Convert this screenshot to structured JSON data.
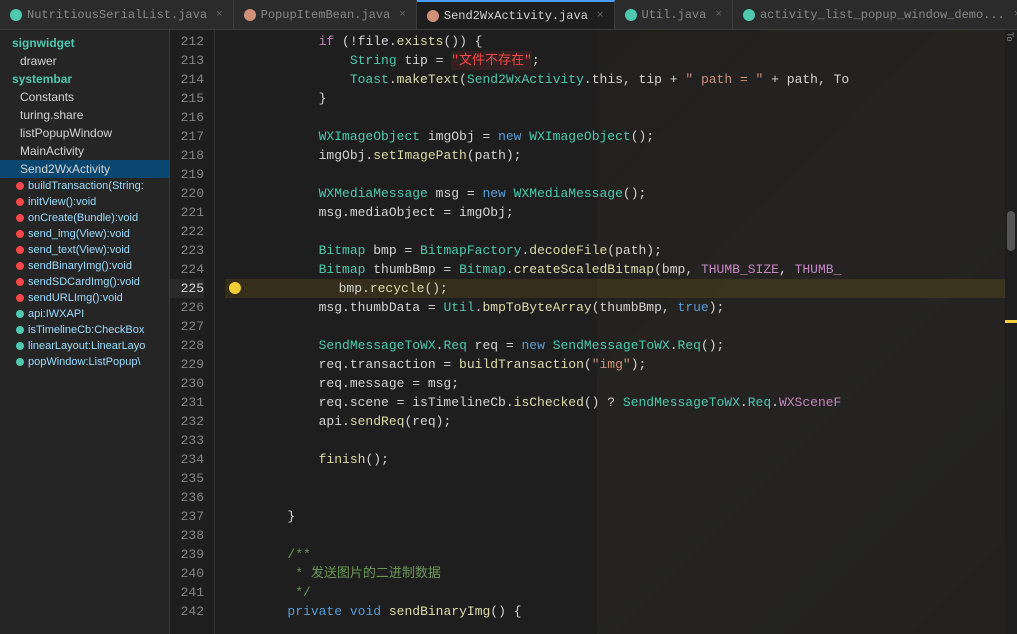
{
  "tabs": [
    {
      "label": "NutritiousSerialList.java",
      "icon": "green",
      "active": false
    },
    {
      "label": "PopupItemBean.java",
      "icon": "orange",
      "active": false
    },
    {
      "label": "Send2WxActivity.java",
      "icon": "orange",
      "active": true
    },
    {
      "label": "Util.java",
      "icon": "green",
      "active": false
    },
    {
      "label": "activity_list_popup_window_demo...",
      "icon": "green",
      "active": false
    }
  ],
  "sidebar": {
    "sections": [
      {
        "label": "signwidget",
        "type": "section-header"
      },
      {
        "label": "drawer",
        "type": "sub-item"
      },
      {
        "label": "systembar",
        "type": "section-header"
      },
      {
        "label": "Constants",
        "type": "sub-item"
      },
      {
        "label": "turing.share",
        "type": "sub-item"
      },
      {
        "label": "listPopupWindow",
        "type": "sub-item"
      },
      {
        "label": "MainActivity",
        "type": "sub-item"
      },
      {
        "label": "Send2WxActivity",
        "type": "sub-item",
        "selected": true
      }
    ],
    "methods": [
      {
        "label": "buildTransaction(String:",
        "dot": "red"
      },
      {
        "label": "initView():void",
        "dot": "red"
      },
      {
        "label": "onCreate(Bundle):void",
        "dot": "red"
      },
      {
        "label": "send_img(View):void",
        "dot": "red"
      },
      {
        "label": "send_text(View):void",
        "dot": "red"
      },
      {
        "label": "sendBinaryImg():void",
        "dot": "red"
      },
      {
        "label": "sendSDCardImg():void",
        "dot": "red"
      },
      {
        "label": "sendURLImg():void",
        "dot": "red"
      },
      {
        "label": "api:IWXAPI",
        "dot": "green"
      },
      {
        "label": "isTimelineCb:CheckBox",
        "dot": "green"
      },
      {
        "label": "linearLayout:LinearLayo",
        "dot": "green"
      },
      {
        "label": "popWindow:ListPopup\\",
        "dot": "green"
      }
    ]
  },
  "lines": [
    {
      "num": 212,
      "content": "if (!file.exists()) {",
      "indent": 3
    },
    {
      "num": 213,
      "content": "String tip = \"文件不存在\";",
      "indent": 4
    },
    {
      "num": 214,
      "content": "Toast.makeText(Send2WxActivity.this, tip + \" path = \" + path, To",
      "indent": 4
    },
    {
      "num": 215,
      "content": "}",
      "indent": 3
    },
    {
      "num": 216,
      "content": "",
      "indent": 0
    },
    {
      "num": 217,
      "content": "WXImageObject imgObj = new WXImageObject();",
      "indent": 3
    },
    {
      "num": 218,
      "content": "imgObj.setImagePath(path);",
      "indent": 3
    },
    {
      "num": 219,
      "content": "",
      "indent": 0
    },
    {
      "num": 220,
      "content": "WXMediaMessage msg = new WXMediaMessage();",
      "indent": 3
    },
    {
      "num": 221,
      "content": "msg.mediaObject = imgObj;",
      "indent": 3
    },
    {
      "num": 222,
      "content": "",
      "indent": 0
    },
    {
      "num": 223,
      "content": "Bitmap bmp = BitmapFactory.decodeFile(path);",
      "indent": 3
    },
    {
      "num": 224,
      "content": "Bitmap thumbBmp = Bitmap.createScaledBitmap(bmp, THUMB_SIZE, THUMB_",
      "indent": 3
    },
    {
      "num": 225,
      "content": "bmp.recycle();",
      "indent": 3,
      "breakpoint": true,
      "highlighted": true
    },
    {
      "num": 226,
      "content": "msg.thumbData = Util.bmpToByteArray(thumbBmp, true);",
      "indent": 3
    },
    {
      "num": 227,
      "content": "",
      "indent": 0
    },
    {
      "num": 228,
      "content": "SendMessageToWX.Req req = new SendMessageToWX.Req();",
      "indent": 3
    },
    {
      "num": 229,
      "content": "req.transaction = buildTransaction(\"img\");",
      "indent": 3
    },
    {
      "num": 230,
      "content": "req.message = msg;",
      "indent": 3
    },
    {
      "num": 231,
      "content": "req.scene = isTimelineCb.isChecked() ? SendMessageToWX.Req.WXSceneF",
      "indent": 3
    },
    {
      "num": 232,
      "content": "api.sendReq(req);",
      "indent": 3
    },
    {
      "num": 233,
      "content": "",
      "indent": 0
    },
    {
      "num": 234,
      "content": "finish();",
      "indent": 3
    },
    {
      "num": 235,
      "content": "",
      "indent": 0
    },
    {
      "num": 236,
      "content": "",
      "indent": 0
    },
    {
      "num": 237,
      "content": "}",
      "indent": 2
    },
    {
      "num": 238,
      "content": "",
      "indent": 0
    },
    {
      "num": 239,
      "content": "/**",
      "indent": 2
    },
    {
      "num": 240,
      "content": " * 发送图片的二进制数据",
      "indent": 2
    },
    {
      "num": 241,
      "content": " */",
      "indent": 2
    },
    {
      "num": 242,
      "content": "private void sendBinaryImg() {",
      "indent": 2
    }
  ],
  "scroll_indicator": {
    "label": "To",
    "position": "right"
  }
}
